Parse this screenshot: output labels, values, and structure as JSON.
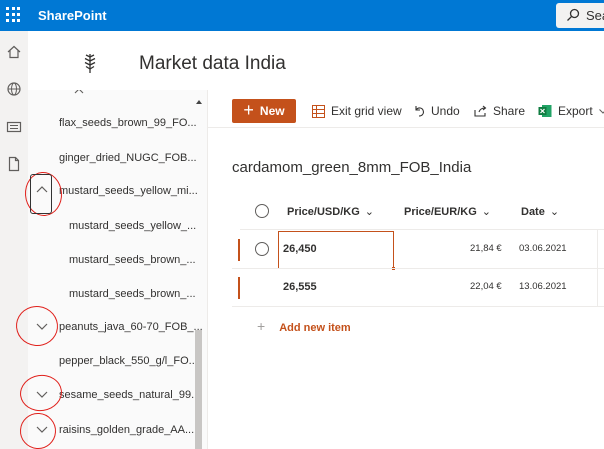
{
  "suite": {
    "app_name": "SharePoint",
    "search_placeholder": "Sea"
  },
  "site": {
    "title": "Market data India"
  },
  "nav": {
    "items": [
      "flax_seeds_brown_99_FO...",
      "ginger_dried_NUGC_FOB...",
      "mustard_seeds_yellow_mi...",
      "mustard_seeds_yellow_...",
      "mustard_seeds_brown_...",
      "mustard_seeds_brown_...",
      "peanuts_java_60-70_FOB_...",
      "pepper_black_550_g/l_FO...",
      "sesame_seeds_natural_99...",
      "raisins_golden_grade_AA..."
    ]
  },
  "commands": {
    "new": "New",
    "exit_grid": "Exit grid view",
    "undo": "Undo",
    "share": "Share",
    "export": "Export"
  },
  "list": {
    "title": "cardamom_green_8mm_FOB_India",
    "columns": [
      "Price/USD/KG",
      "Price/EUR/KG",
      "Date"
    ],
    "rows": [
      {
        "usd": "26,450",
        "eur": "21,84 €",
        "date": "03.06.2021"
      },
      {
        "usd": "26,555",
        "eur": "22,04 €",
        "date": "13.06.2021"
      }
    ],
    "add_new": "Add new item"
  },
  "colors": {
    "suite_bar": "#0078d4",
    "accent": "#c4511b",
    "annotation": "#e0201b"
  }
}
